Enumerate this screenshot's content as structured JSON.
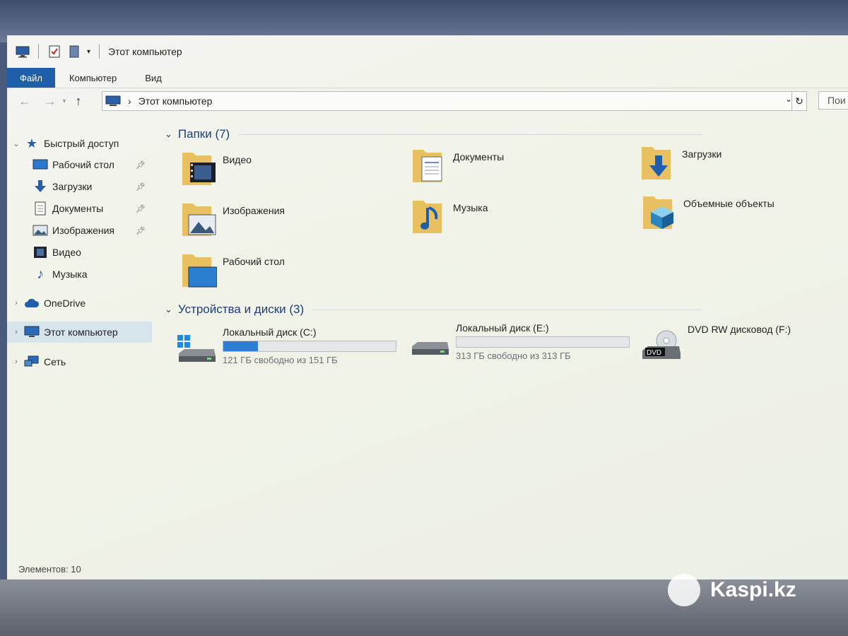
{
  "window": {
    "title": "Этот компьютер"
  },
  "ribbon": {
    "tabs": [
      {
        "label": "Файл",
        "active": true
      },
      {
        "label": "Компьютер"
      },
      {
        "label": "Вид"
      }
    ]
  },
  "address": {
    "path": "Этот компьютер",
    "search_placeholder": "Пои"
  },
  "navigation": {
    "quick_access": "Быстрый доступ",
    "quick_items": [
      {
        "label": "Рабочий стол",
        "pinned": true,
        "icon": "desktop-icon"
      },
      {
        "label": "Загрузки",
        "pinned": true,
        "icon": "downloads-icon"
      },
      {
        "label": "Документы",
        "pinned": true,
        "icon": "documents-icon"
      },
      {
        "label": "Изображения",
        "pinned": true,
        "icon": "pictures-icon"
      },
      {
        "label": "Видео",
        "pinned": false,
        "icon": "videos-icon"
      },
      {
        "label": "Музыка",
        "pinned": false,
        "icon": "music-icon"
      }
    ],
    "onedrive": "OneDrive",
    "this_pc": "Этот компьютер",
    "network": "Сеть"
  },
  "folders": {
    "header": "Папки (7)",
    "items": [
      {
        "label": "Видео",
        "icon": "videos-folder-icon"
      },
      {
        "label": "Документы",
        "icon": "documents-folder-icon"
      },
      {
        "label": "Загрузки",
        "icon": "downloads-folder-icon"
      },
      {
        "label": "Изображения",
        "icon": "pictures-folder-icon"
      },
      {
        "label": "Музыка",
        "icon": "music-folder-icon"
      },
      {
        "label": "Объемные объекты",
        "icon": "3d-objects-folder-icon"
      },
      {
        "label": "Рабочий стол",
        "icon": "desktop-folder-icon"
      }
    ]
  },
  "devices": {
    "header": "Устройства и диски (3)",
    "items": [
      {
        "name": "Локальный диск (C:)",
        "free": "121 ГБ свободно из 151 ГБ",
        "used_fraction": 0.2,
        "icon": "windows-drive-icon"
      },
      {
        "name": "Локальный диск (E:)",
        "free": "313 ГБ свободно из 313 ГБ",
        "used_fraction": 0.0,
        "icon": "drive-icon"
      },
      {
        "name": "DVD RW дисковод (F:)",
        "icon": "dvd-drive-icon",
        "badge": "DVD"
      }
    ]
  },
  "status": {
    "items": "Элементов: 10"
  },
  "watermark": "Kaspi.kz",
  "colors": {
    "accent": "#1f5ea8",
    "drive_fill": "#2e7fd4",
    "folder": "#e8c062"
  }
}
